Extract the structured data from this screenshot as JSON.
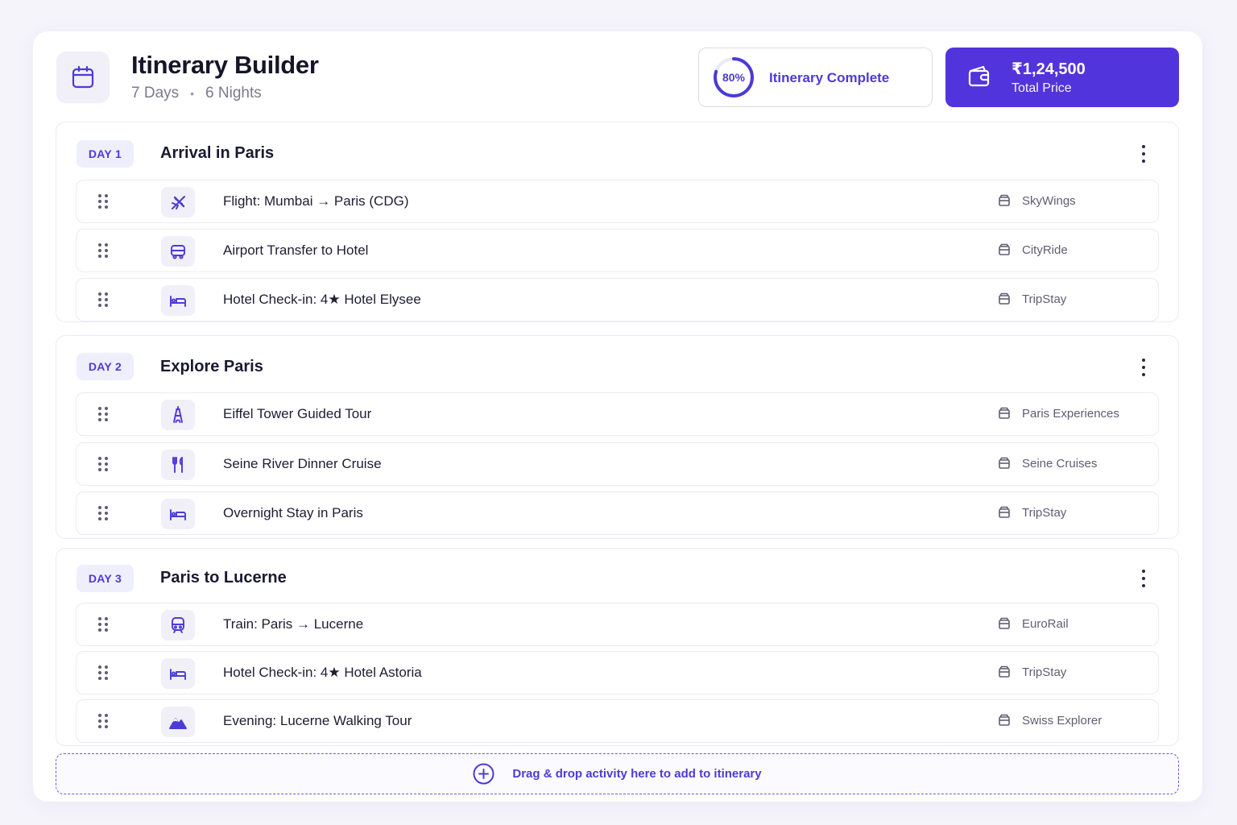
{
  "header": {
    "title": "Itinerary Builder",
    "days": "7 Days",
    "separator": "•",
    "nights": "6 Nights",
    "calendar_icon": "calendar-icon"
  },
  "progress": {
    "percent": 80,
    "percent_label": "80%",
    "label": "Itinerary Complete"
  },
  "price": {
    "amount": "₹1,24,500",
    "label": "Total Price",
    "icon": "wallet-icon"
  },
  "colors": {
    "accent": "#5234dc",
    "accent_text": "#4c3bd6",
    "badge_bg": "#efeefc"
  },
  "days": [
    {
      "badge": "DAY 1",
      "title": "Arrival in Paris",
      "activities": [
        {
          "icon": "plane-icon",
          "name": "Flight: Mumbai → Paris (CDG)",
          "vendor": "SkyWings"
        },
        {
          "icon": "bus-icon",
          "name": "Airport Transfer to Hotel",
          "vendor": "CityRide"
        },
        {
          "icon": "bed-icon",
          "name": "Hotel Check-in: 4★ Hotel Elysee",
          "vendor": "TripStay"
        }
      ]
    },
    {
      "badge": "DAY 2",
      "title": "Explore Paris",
      "activities": [
        {
          "icon": "eiffel-tower-icon",
          "name": "Eiffel Tower Guided Tour",
          "vendor": "Paris Experiences"
        },
        {
          "icon": "fork-knife-icon",
          "name": "Seine River Dinner Cruise",
          "vendor": "Seine Cruises"
        },
        {
          "icon": "bed-icon",
          "name": "Overnight Stay in Paris",
          "vendor": "TripStay"
        }
      ]
    },
    {
      "badge": "DAY 3",
      "title": "Paris to Lucerne",
      "activities": [
        {
          "icon": "train-icon",
          "name": "Train: Paris → Lucerne",
          "vendor": "EuroRail"
        },
        {
          "icon": "bed-icon",
          "name": "Hotel Check-in: 4★ Hotel Astoria",
          "vendor": "TripStay"
        },
        {
          "icon": "mountain-icon",
          "name": "Evening: Lucerne Walking Tour",
          "vendor": "Swiss Explorer"
        }
      ]
    }
  ],
  "dropzone": {
    "text": "Drag  & drop activity here to add to itinerary",
    "icon": "plus-circle-icon"
  }
}
